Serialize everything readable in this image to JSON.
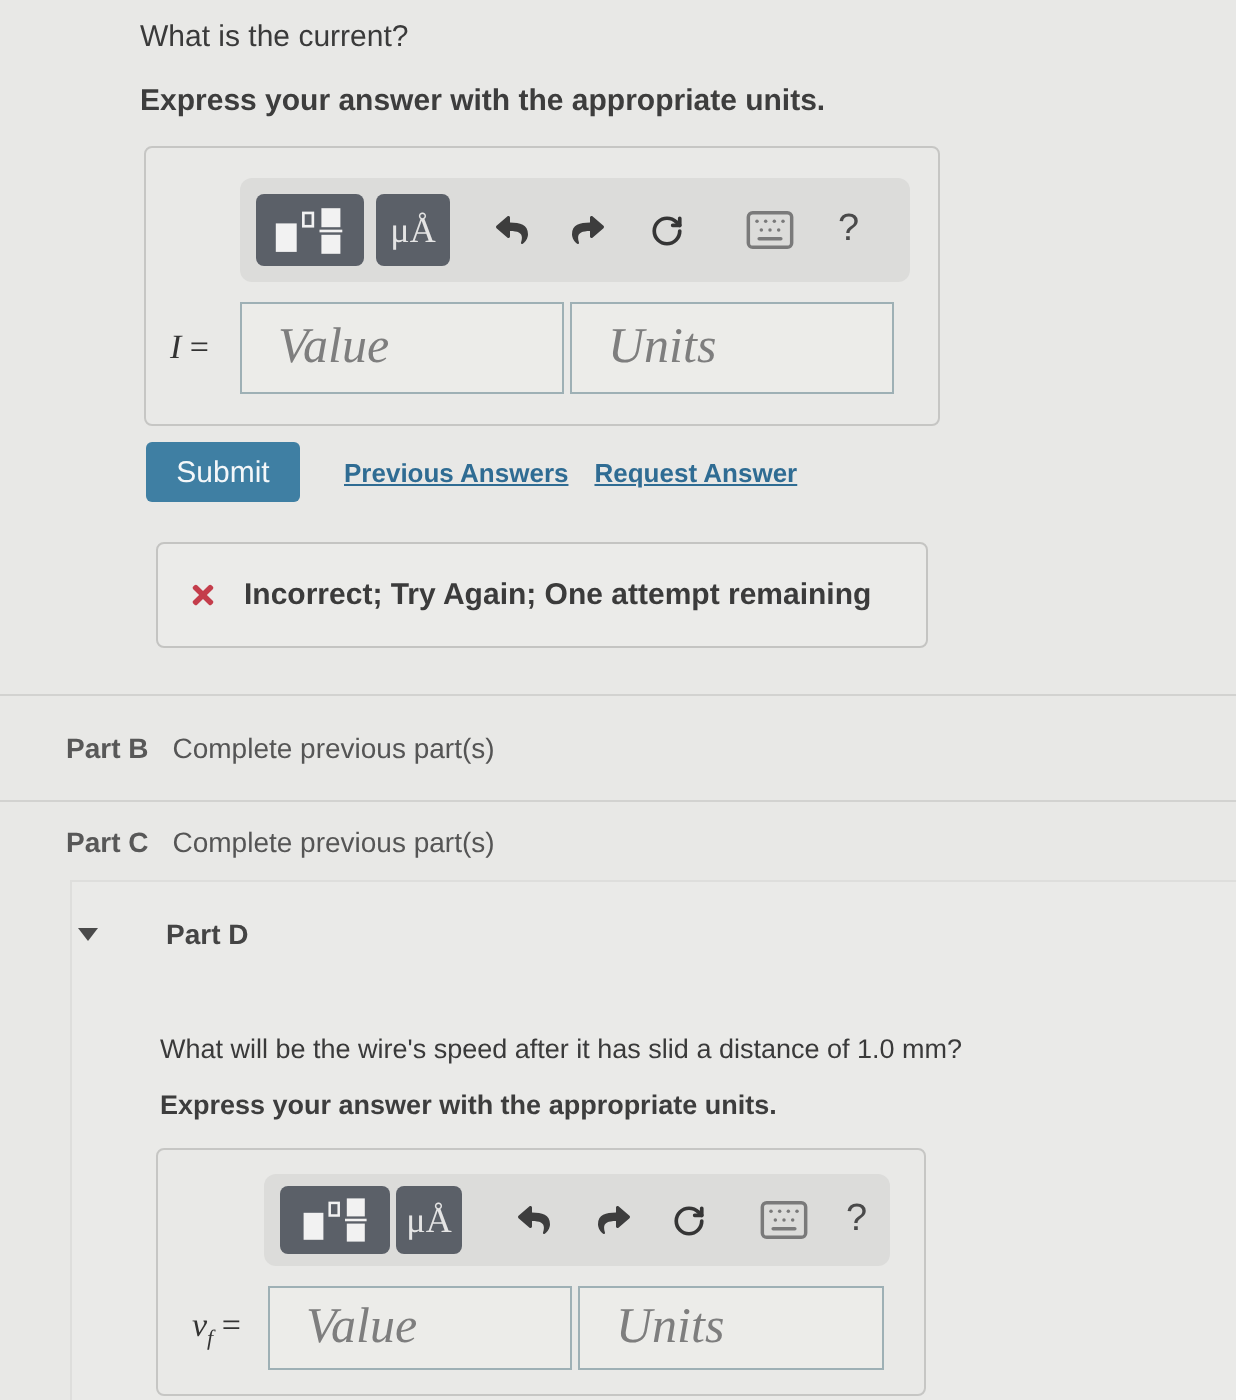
{
  "part_a": {
    "question": "What is the current?",
    "instruction": "Express your answer with the appropriate units.",
    "toolbar": [
      {
        "kind": "template"
      },
      {
        "kind": "units",
        "label": "μÅ"
      },
      {
        "kind": "undo"
      },
      {
        "kind": "redo"
      },
      {
        "kind": "reset"
      },
      {
        "kind": "keyboard"
      },
      {
        "kind": "help",
        "label": "?"
      }
    ],
    "variable": "*I* =",
    "value_field": {
      "placeholder": "Value"
    },
    "units_field": {
      "placeholder": "Units"
    },
    "submit": "Submit",
    "links": [
      "Previous Answers",
      "Request Answer"
    ],
    "feedback": {
      "kind": "incorrect",
      "text": "Incorrect; Try Again; One attempt remaining"
    }
  },
  "collapsed_parts": [
    {
      "label": "Part B",
      "status": "Complete previous part(s)"
    },
    {
      "label": "Part C",
      "status": "Complete previous part(s)"
    }
  ],
  "part_d": {
    "label": "Part D",
    "expanded": true,
    "question": "What will be the wire's speed after it has slid a distance of 1.0 mm?",
    "instruction": "Express your answer with the appropriate units.",
    "toolbar": [
      {
        "kind": "template"
      },
      {
        "kind": "units",
        "label": "μÅ"
      },
      {
        "kind": "undo"
      },
      {
        "kind": "redo"
      },
      {
        "kind": "reset"
      },
      {
        "kind": "keyboard"
      },
      {
        "kind": "help",
        "label": "?"
      }
    ],
    "variable": "*v*$_{f}$ =",
    "value_field": {
      "placeholder": "Value"
    },
    "units_field": {
      "placeholder": "Units"
    }
  }
}
